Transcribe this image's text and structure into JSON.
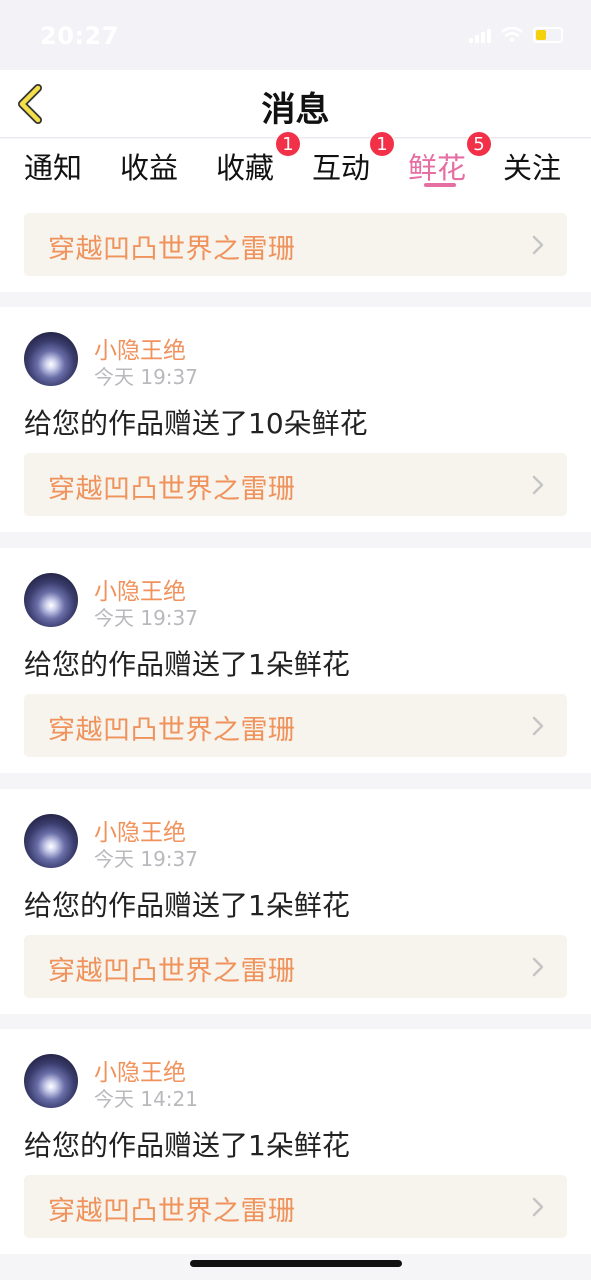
{
  "status_bar": {
    "time": "20:27"
  },
  "header": {
    "title": "消息"
  },
  "tabs": [
    {
      "label": "通知",
      "badge": ""
    },
    {
      "label": "收益",
      "badge": ""
    },
    {
      "label": "收藏",
      "badge": "1"
    },
    {
      "label": "互动",
      "badge": "1"
    },
    {
      "label": "鲜花",
      "badge": "5",
      "active": true
    },
    {
      "label": "关注",
      "badge": ""
    }
  ],
  "top_work": {
    "title": "穿越凹凸世界之雷珊"
  },
  "items": [
    {
      "username": "小隐王绝",
      "time": "今天 19:37",
      "message": "给您的作品赠送了10朵鲜花",
      "work_title": "穿越凹凸世界之雷珊"
    },
    {
      "username": "小隐王绝",
      "time": "今天 19:37",
      "message": "给您的作品赠送了1朵鲜花",
      "work_title": "穿越凹凸世界之雷珊"
    },
    {
      "username": "小隐王绝",
      "time": "今天 19:37",
      "message": "给您的作品赠送了1朵鲜花",
      "work_title": "穿越凹凸世界之雷珊"
    },
    {
      "username": "小隐王绝",
      "time": "今天 14:21",
      "message": "给您的作品赠送了1朵鲜花",
      "work_title": "穿越凹凸世界之雷珊"
    }
  ],
  "colors": {
    "accent_pink": "#e56fa2",
    "work_orange": "#f0925c",
    "badge_red": "#f23048",
    "back_yellow": "#f2df4a"
  },
  "icons": {
    "back": "chevron-left-icon",
    "work_arrow": "chevron-right-icon",
    "avatar": "avatar-image"
  }
}
